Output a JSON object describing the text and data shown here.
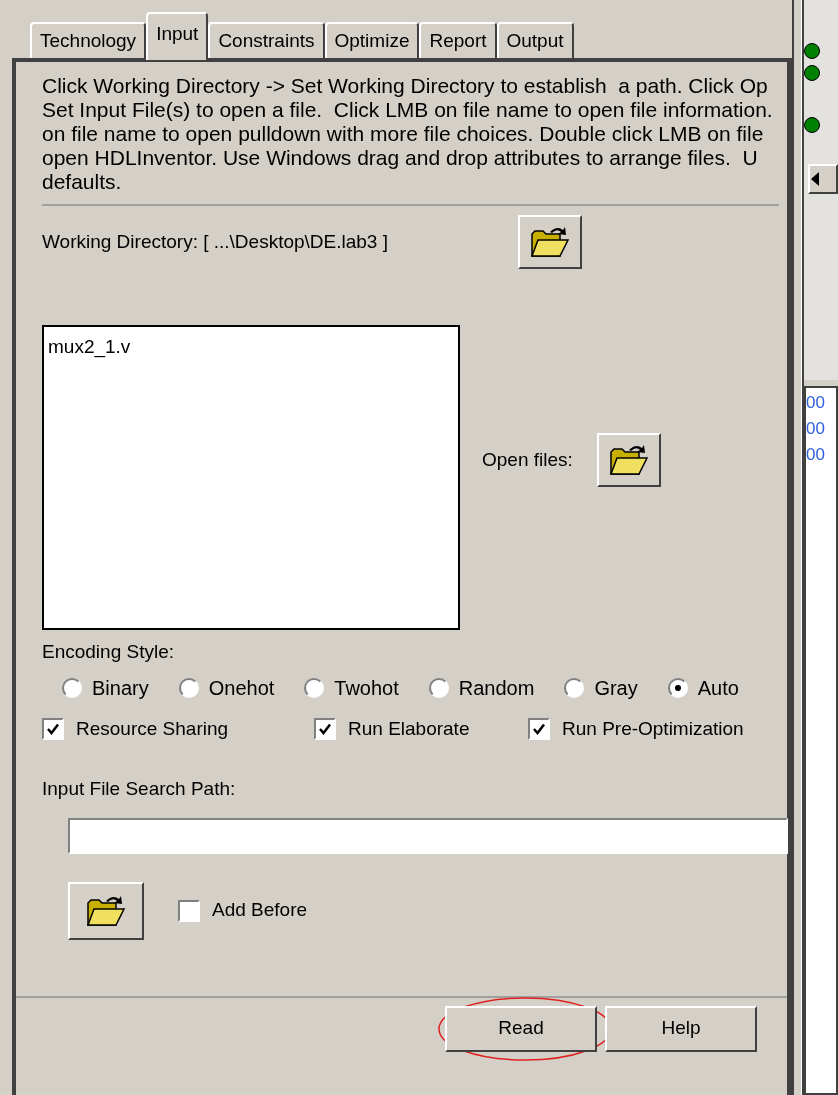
{
  "tabs": [
    {
      "label": "Technology",
      "selected": false
    },
    {
      "label": "Input",
      "selected": true
    },
    {
      "label": "Constraints",
      "selected": false
    },
    {
      "label": "Optimize",
      "selected": false
    },
    {
      "label": "Report",
      "selected": false
    },
    {
      "label": "Output",
      "selected": false
    }
  ],
  "description_lines": [
    "Click Working Directory -> Set Working Directory to establish  a path. Click Op",
    "Set Input File(s) to open a file.  Click LMB on file name to open file information.",
    "on file name to open pulldown with more file choices. Double click LMB on file",
    "open HDLInventor. Use Windows drag and drop attributes to arrange files.  U",
    "defaults."
  ],
  "working_directory": {
    "label": "Working Directory: [ ...\\Desktop\\DE.lab3 ]"
  },
  "file_list": [
    "mux2_1.v"
  ],
  "open_files_label": "Open files:",
  "encoding_style": {
    "label": "Encoding Style:",
    "options": [
      {
        "label": "Binary",
        "selected": false
      },
      {
        "label": "Onehot",
        "selected": false
      },
      {
        "label": "Twohot",
        "selected": false
      },
      {
        "label": "Random",
        "selected": false
      },
      {
        "label": "Gray",
        "selected": false
      },
      {
        "label": "Auto",
        "selected": true
      }
    ]
  },
  "options": [
    {
      "label": "Resource Sharing",
      "checked": true
    },
    {
      "label": "Run Elaborate",
      "checked": true
    },
    {
      "label": "Run Pre-Optimization",
      "checked": true
    }
  ],
  "search_path": {
    "label": "Input File Search Path:"
  },
  "add_before": {
    "label": "Add Before",
    "checked": false
  },
  "buttons": [
    "Read",
    "Help"
  ],
  "side_panel": {
    "log_lines": [
      "00",
      "00",
      "00"
    ]
  }
}
